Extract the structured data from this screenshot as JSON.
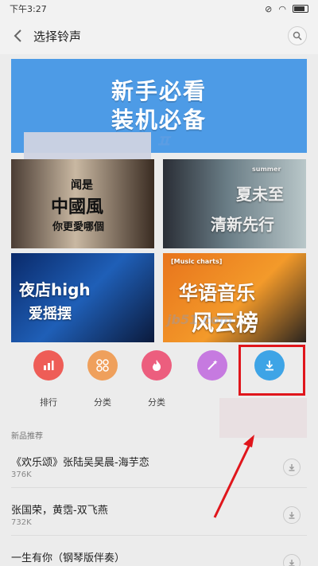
{
  "status_bar": {
    "time": "下午3:27"
  },
  "header": {
    "title": "选择铃声",
    "back_icon": "chevron-left-icon",
    "search_icon": "search-icon"
  },
  "banner": {
    "line1": "新手必看",
    "line2": "装机必备"
  },
  "tiles": [
    {
      "line1": "闻是",
      "line2": "中國風",
      "line3": "你更愛哪個"
    },
    {
      "line1": "夏未至",
      "line2": "清新先行",
      "tag": "summer"
    },
    {
      "line1": "夜店high",
      "line2": "爱摇摆"
    },
    {
      "tag": "[Music charts]",
      "line1": "华语音乐",
      "line2": "风云榜"
    }
  ],
  "categories": [
    {
      "label": "排行",
      "icon": "bar-chart-icon",
      "color": "#ee5d57"
    },
    {
      "label": "分类",
      "icon": "grid-icon",
      "color": "#efa05c"
    },
    {
      "label": "分类",
      "icon": "flame-icon",
      "color": "#ec5e7e"
    },
    {
      "label": "",
      "icon": "magic-wand-icon",
      "color": "#c67ae0"
    },
    {
      "label": "",
      "icon": "download-icon",
      "color": "#3ea4e6"
    }
  ],
  "section": {
    "title": "新品推荐"
  },
  "songs": [
    {
      "name": "《欢乐颂》张陆吴昊晨-海芋恋",
      "size": "376K"
    },
    {
      "name": "张国荣，黄霑-双飞燕",
      "size": "732K"
    },
    {
      "name": "一生有你（钢琴版伴奏）",
      "size": ""
    }
  ],
  "watermark": {
    "text": "jb51.com"
  }
}
